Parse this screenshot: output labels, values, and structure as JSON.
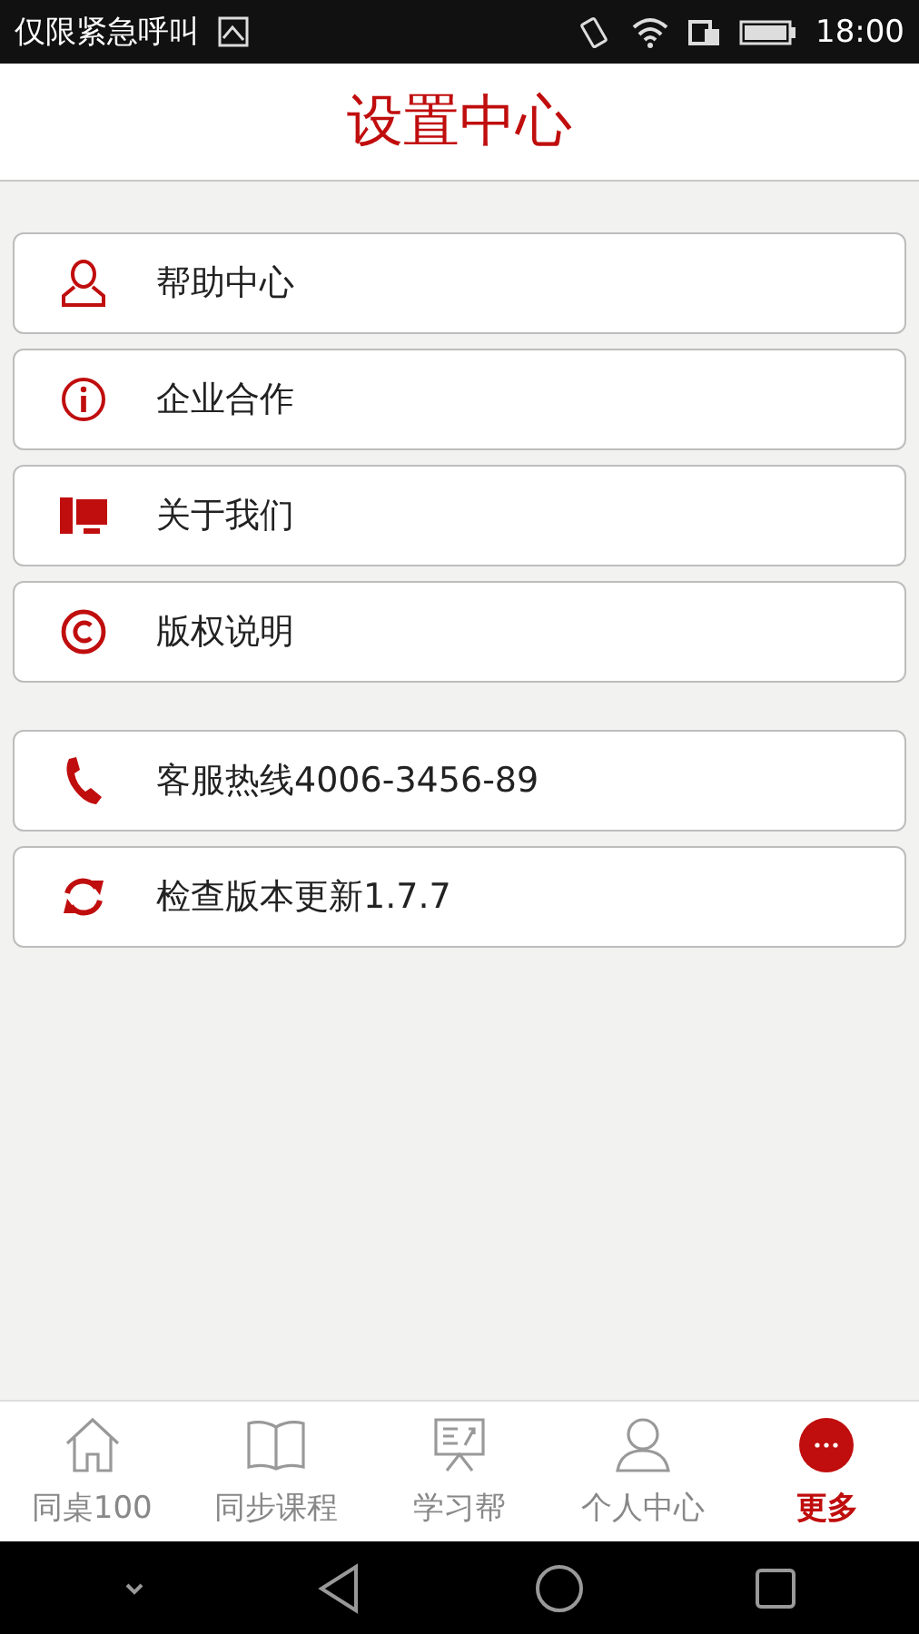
{
  "status_bar": {
    "carrier": "仅限紧急呼叫",
    "time": "18:00"
  },
  "header": {
    "title": "设置中心"
  },
  "menu_groups": [
    [
      {
        "kind": "user",
        "label": "帮助中心"
      },
      {
        "kind": "info",
        "label": "企业合作"
      },
      {
        "kind": "computer",
        "label": "关于我们"
      },
      {
        "kind": "copyright",
        "label": "版权说明"
      }
    ],
    [
      {
        "kind": "phone",
        "label": "客服热线4006-3456-89"
      },
      {
        "kind": "refresh",
        "label": "检查版本更新1.7.7"
      }
    ]
  ],
  "tabs": [
    {
      "kind": "home",
      "label": "同桌100",
      "selected": false
    },
    {
      "kind": "book",
      "label": "同步课程",
      "selected": false
    },
    {
      "kind": "board",
      "label": "学习帮",
      "selected": false
    },
    {
      "kind": "person",
      "label": "个人中心",
      "selected": false
    },
    {
      "kind": "more",
      "label": "更多",
      "selected": true
    }
  ]
}
